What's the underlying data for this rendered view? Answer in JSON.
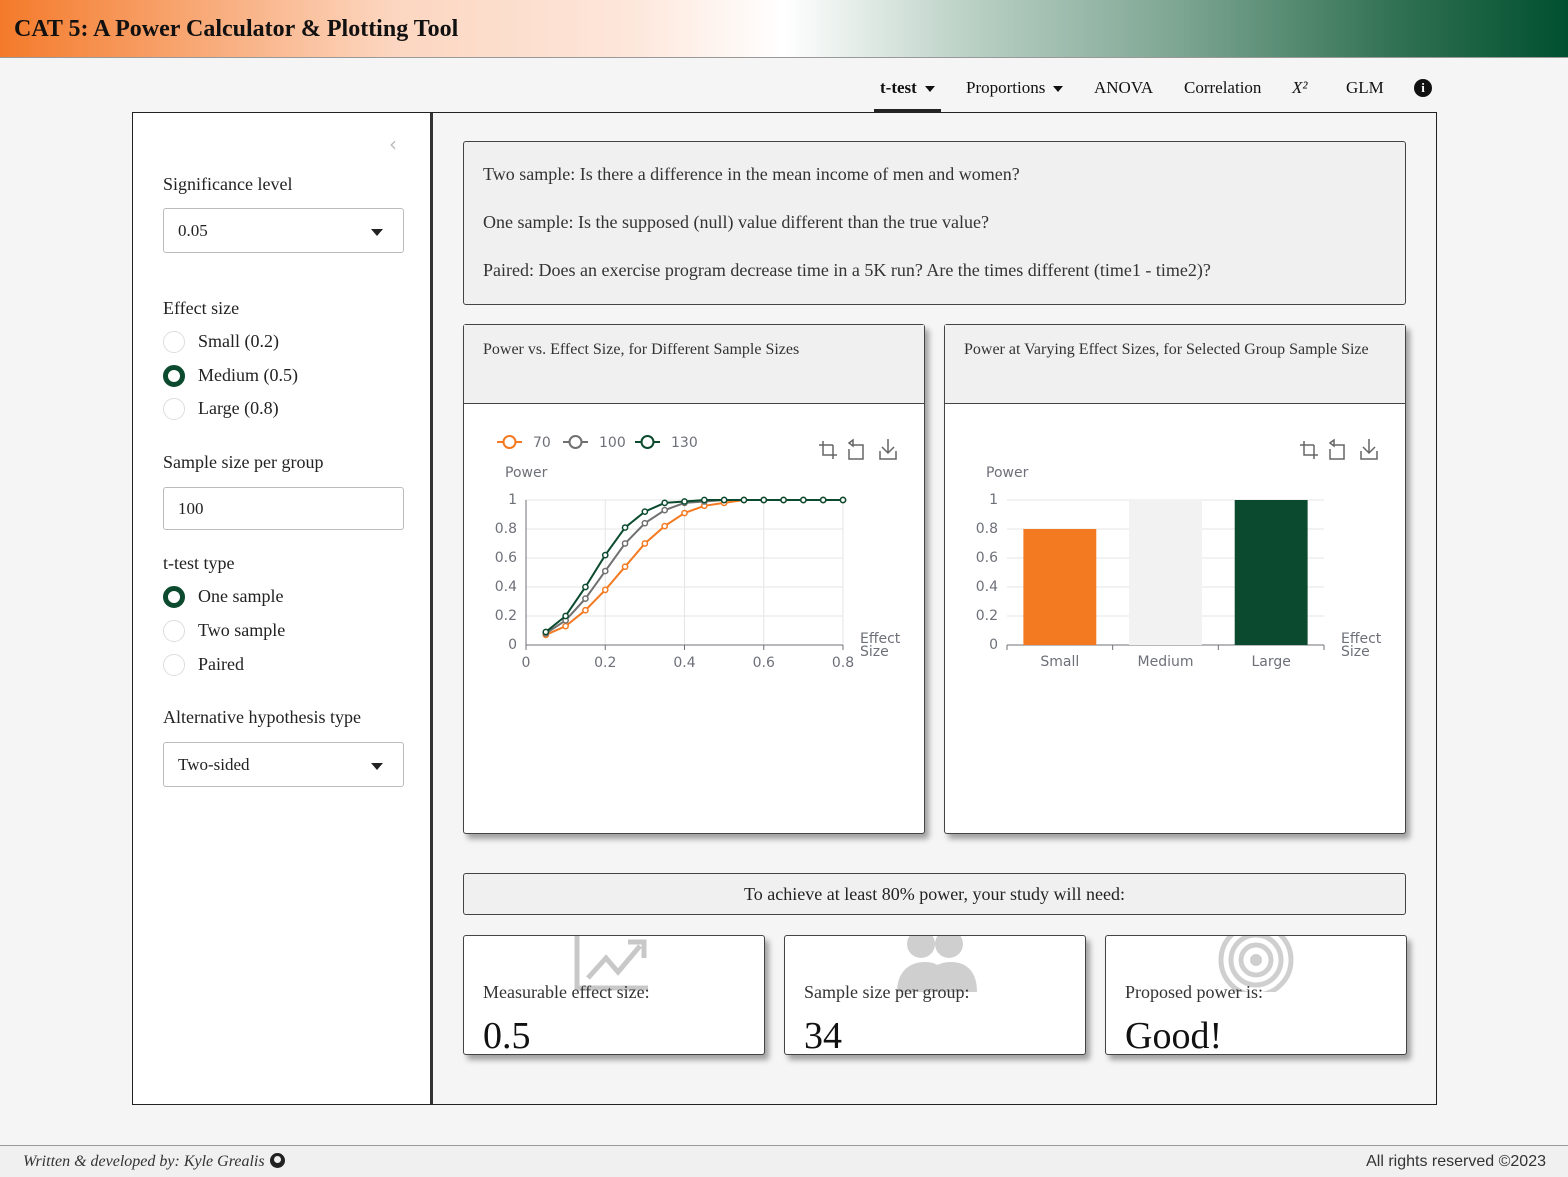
{
  "app": {
    "title": "CAT 5: A Power Calculator & Plotting Tool"
  },
  "nav": {
    "items": [
      {
        "label": "t-test",
        "dropdown": true,
        "active": true
      },
      {
        "label": "Proportions",
        "dropdown": true
      },
      {
        "label": "ANOVA"
      },
      {
        "label": "Correlation"
      },
      {
        "label": "X²"
      },
      {
        "label": "GLM"
      }
    ],
    "info_icon": "info-circle-icon"
  },
  "sidebar": {
    "collapse_icon": "chevron-left-icon",
    "significance": {
      "label": "Significance level",
      "value": "0.05"
    },
    "effect_size": {
      "label": "Effect size",
      "options": [
        "Small (0.2)",
        "Medium (0.5)",
        "Large (0.8)"
      ],
      "selected": 1
    },
    "sample_size": {
      "label": "Sample size per group",
      "value": "100"
    },
    "ttest_type": {
      "label": "t-test type",
      "options": [
        "One sample",
        "Two sample",
        "Paired"
      ],
      "selected": 0
    },
    "alternative": {
      "label": "Alternative hypothesis type",
      "value": "Two-sided"
    }
  },
  "questions": [
    "Two sample: Is there a difference in the mean income of men and women?",
    "One sample: Is the supposed (null) value different than the true value?",
    "Paired: Does an exercise program decrease time in a 5K run? Are the times different (time1 - time2)?"
  ],
  "cards": {
    "line_title": "Power vs. Effect Size, for Different Sample Sizes",
    "bar_title": "Power at Varying Effect Sizes, for Selected Group Sample Size",
    "toolbar_icons": [
      "zoom-icon",
      "restore-icon",
      "download-icon"
    ]
  },
  "colors": {
    "orange": "#f47a22",
    "gray": "#707070",
    "green": "#0b4a2e",
    "light": "#f2f2f2"
  },
  "chart_data": [
    {
      "type": "line",
      "ylabel": "Power",
      "xlabel": "Effect Size",
      "xlim": [
        0,
        0.8
      ],
      "ylim": [
        0,
        1
      ],
      "xticks": [
        "0",
        "0.2",
        "0.4",
        "0.6",
        "0.8"
      ],
      "yticks": [
        "0",
        "0.2",
        "0.4",
        "0.6",
        "0.8",
        "1"
      ],
      "legend_position": "top-left",
      "x": [
        0.05,
        0.1,
        0.15,
        0.2,
        0.25,
        0.3,
        0.35,
        0.4,
        0.45,
        0.5,
        0.55,
        0.6,
        0.65,
        0.7,
        0.75,
        0.8
      ],
      "series": [
        {
          "name": "70",
          "color": "#f47a22",
          "values": [
            0.07,
            0.13,
            0.24,
            0.38,
            0.54,
            0.7,
            0.82,
            0.91,
            0.96,
            0.98,
            1,
            1,
            1,
            1,
            1,
            1
          ]
        },
        {
          "name": "100",
          "color": "#707070",
          "values": [
            0.08,
            0.17,
            0.32,
            0.51,
            0.7,
            0.84,
            0.93,
            0.98,
            0.99,
            1,
            1,
            1,
            1,
            1,
            1,
            1
          ]
        },
        {
          "name": "130",
          "color": "#0b4a2e",
          "values": [
            0.09,
            0.2,
            0.4,
            0.62,
            0.81,
            0.92,
            0.98,
            0.99,
            1,
            1,
            1,
            1,
            1,
            1,
            1,
            1
          ]
        }
      ]
    },
    {
      "type": "bar",
      "ylabel": "Power",
      "xlabel": "Effect Size",
      "ylim": [
        0,
        1
      ],
      "yticks": [
        "0",
        "0.2",
        "0.4",
        "0.6",
        "0.8",
        "1"
      ],
      "categories": [
        "Small",
        "Medium",
        "Large"
      ],
      "values": [
        0.8,
        1,
        1
      ],
      "colors": [
        "#f47a22",
        "#f2f2f2",
        "#0b4a2e"
      ]
    }
  ],
  "summary": {
    "banner": "To achieve at least 80% power, your study will need:",
    "boxes": [
      {
        "label": "Measurable effect size:",
        "value": "0.5",
        "icon": "chart-line-icon"
      },
      {
        "label": "Sample size per group:",
        "value": "34",
        "icon": "users-icon"
      },
      {
        "label": "Proposed power is:",
        "value": "Good!",
        "icon": "target-icon"
      }
    ]
  },
  "footer": {
    "credit": "Written & developed by: Kyle Grealis",
    "rights": "All rights reserved ©2023"
  }
}
